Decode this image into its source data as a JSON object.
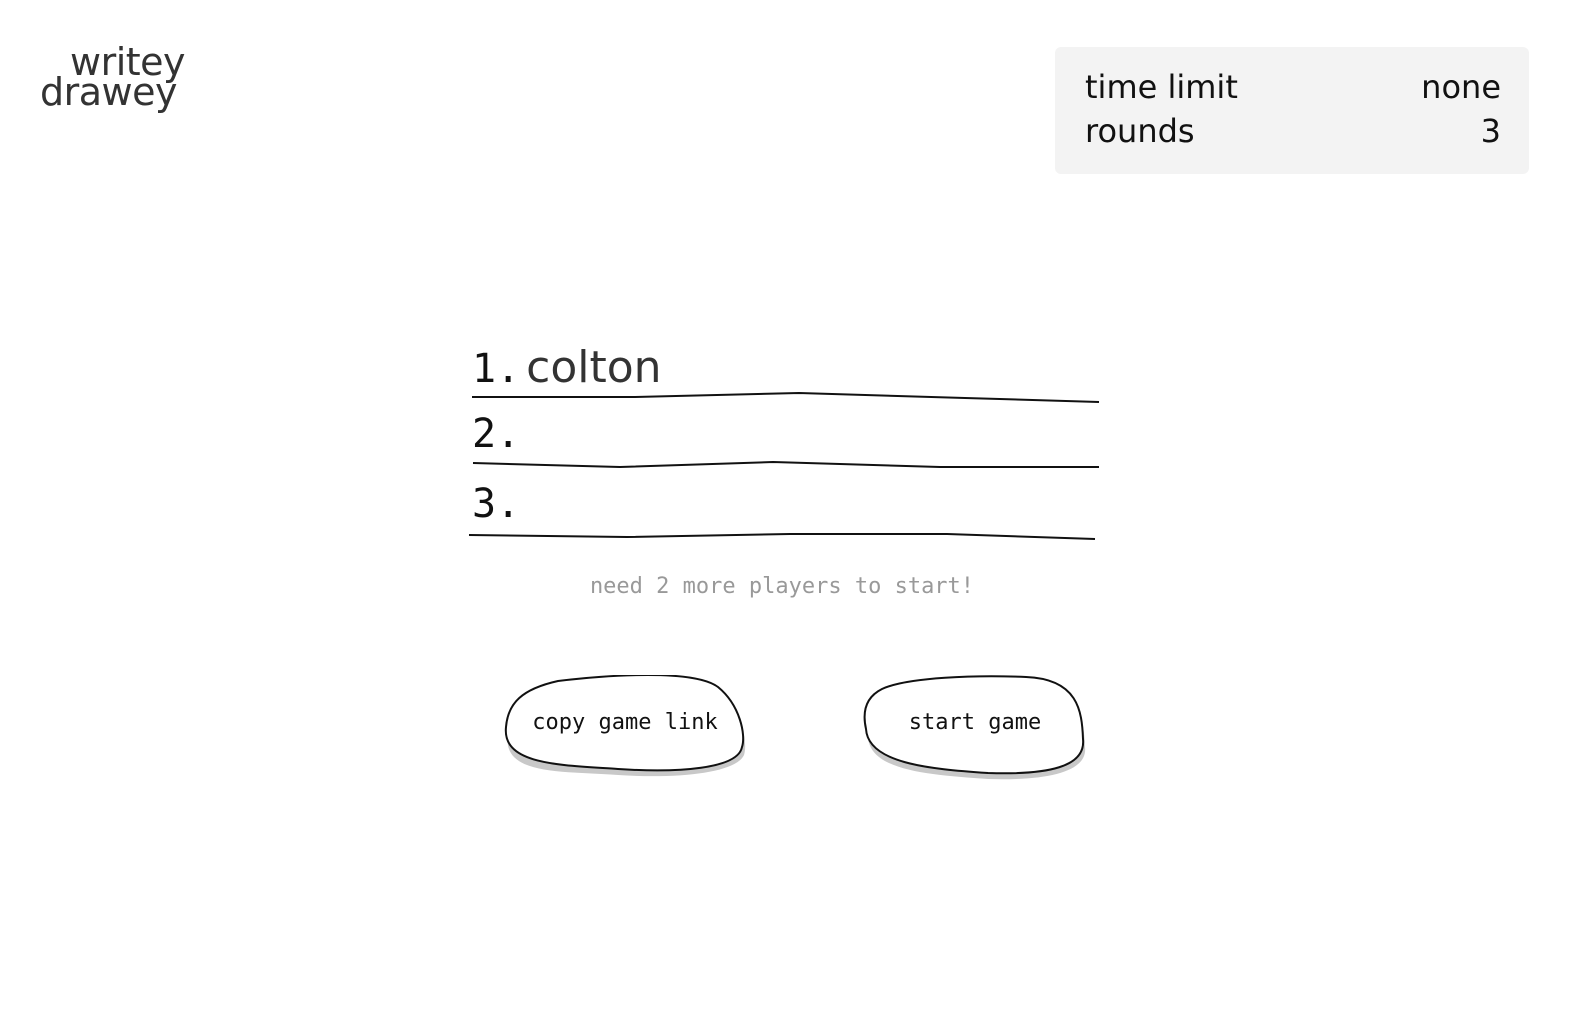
{
  "logo": {
    "line1": "writey",
    "line2": "drawey"
  },
  "settings": {
    "rows": [
      {
        "label": "time limit",
        "value": "none"
      },
      {
        "label": "rounds",
        "value": "3"
      }
    ]
  },
  "players": [
    {
      "number": "1.",
      "name": "colton"
    },
    {
      "number": "2.",
      "name": ""
    },
    {
      "number": "3.",
      "name": ""
    }
  ],
  "status_message": "need 2 more players to start!",
  "buttons": {
    "copy_link": "copy game link",
    "start": "start game"
  }
}
